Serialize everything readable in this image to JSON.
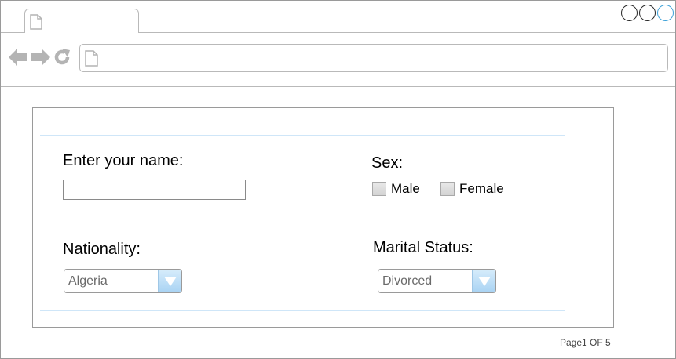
{
  "browser": {
    "tab": {
      "icon": "page-icon"
    },
    "window_controls": [
      "circle",
      "circle",
      "circle-active"
    ],
    "nav": {
      "back_icon": "back-arrow-icon",
      "forward_icon": "forward-arrow-icon",
      "reload_icon": "reload-icon"
    },
    "address_bar": {
      "icon": "page-icon",
      "value": ""
    }
  },
  "form": {
    "name_label": "Enter your name:",
    "name_value": "",
    "sex_label": "Sex:",
    "sex_options": [
      {
        "label": "Male",
        "checked": false
      },
      {
        "label": "Female",
        "checked": false
      }
    ],
    "nationality_label": "Nationality:",
    "nationality_value": "Algeria",
    "marital_label": "Marital Status:",
    "marital_value": "Divorced"
  },
  "pager": {
    "text": "Page1 OF 5"
  },
  "colors": {
    "accent": "#3aa0d8",
    "rule": "#cfe6f8",
    "dropdown": "#a9d3f3",
    "icon_gray": "#b4b4b4"
  }
}
